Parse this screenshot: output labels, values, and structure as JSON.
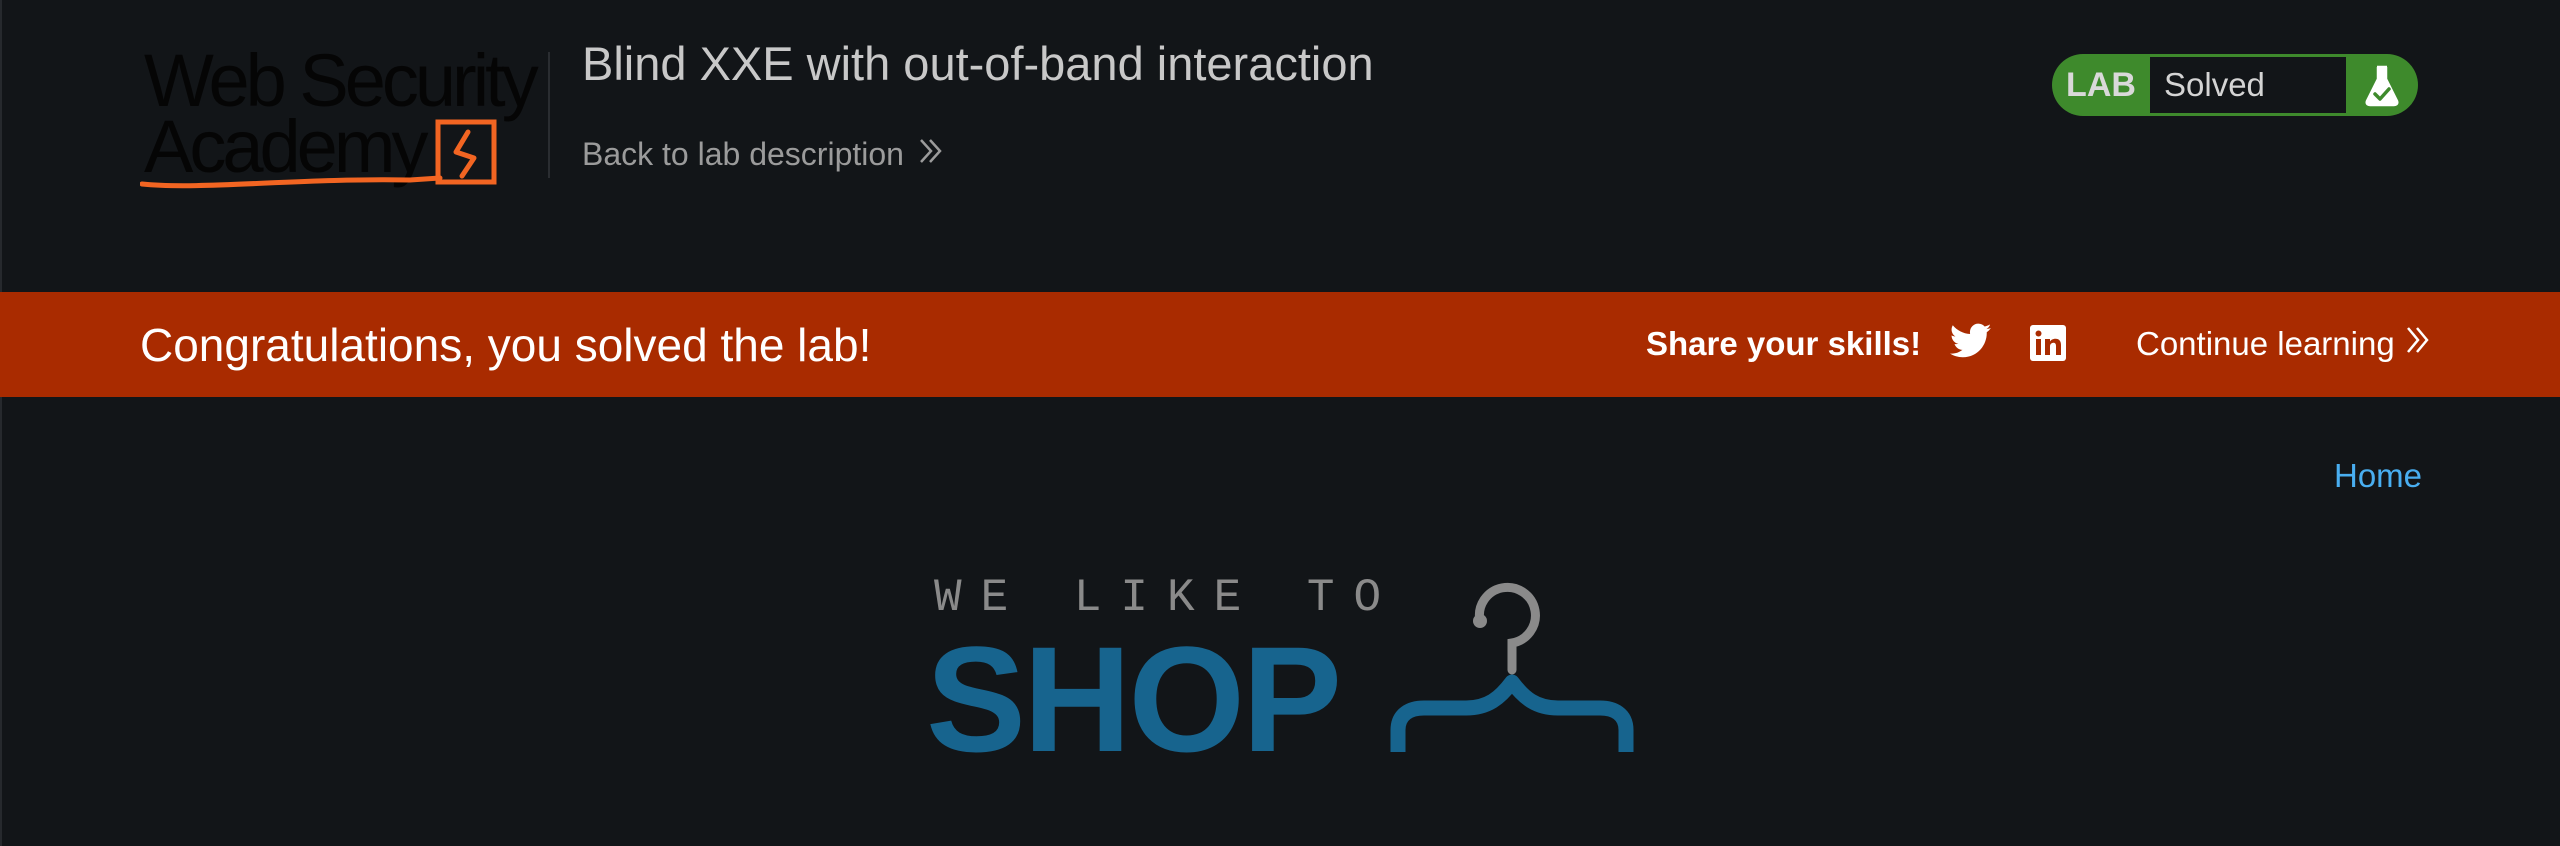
{
  "header": {
    "logo_line1": "Web Security",
    "logo_line2": "Academy",
    "lab_title": "Blind XXE with out-of-band interaction",
    "back_link": "Back to lab description"
  },
  "lab_status": {
    "tag": "LAB",
    "status": "Solved",
    "icon": "flask-icon",
    "color": "#3e8a2c"
  },
  "banner": {
    "message": "Congratulations, you solved the lab!",
    "share_label": "Share your skills!",
    "social_icons": [
      "twitter-icon",
      "linkedin-icon"
    ],
    "continue_label": "Continue learning",
    "color": "#a92b00"
  },
  "nav": {
    "home": "Home"
  },
  "shop_logo": {
    "tagline": "WE LIKE TO",
    "word": "SHOP",
    "icon": "hanger-icon",
    "color": "#17648e"
  }
}
